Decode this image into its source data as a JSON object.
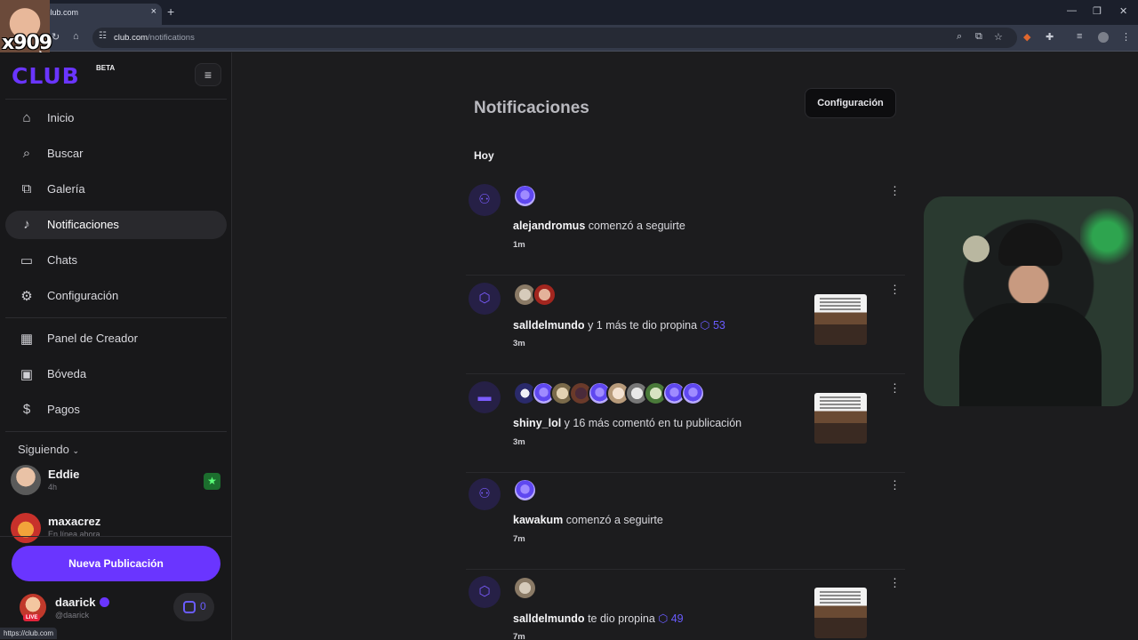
{
  "browser": {
    "tab_title": "club.com",
    "url_host": "club.com",
    "url_path": "/notifications",
    "status_url": "https://club.com"
  },
  "overlay": {
    "streamer_text": "x909"
  },
  "sidebar": {
    "logo": "CLUB",
    "beta": "BETA",
    "nav": [
      {
        "label": "Inicio",
        "icon": "home-icon"
      },
      {
        "label": "Buscar",
        "icon": "search-icon"
      },
      {
        "label": "Galería",
        "icon": "gallery-icon"
      },
      {
        "label": "Notificaciones",
        "icon": "bell-icon",
        "active": true
      },
      {
        "label": "Chats",
        "icon": "chat-icon"
      },
      {
        "label": "Configuración",
        "icon": "gear-icon"
      },
      {
        "label": "Panel de Creador",
        "icon": "dashboard-icon"
      },
      {
        "label": "Bóveda",
        "icon": "vault-icon"
      },
      {
        "label": "Pagos",
        "icon": "dollar-icon"
      }
    ],
    "following_label": "Siguiendo",
    "following": [
      {
        "name": "Eddie",
        "sub": "4h",
        "live": true
      },
      {
        "name": "maxacrez",
        "sub": "En línea ahora"
      }
    ],
    "new_post_label": "Nueva Publicación",
    "me": {
      "name": "daarick",
      "handle": "@daarick",
      "live_label": "LIVE",
      "coins": "0"
    }
  },
  "main": {
    "title": "Notificaciones",
    "config_label": "Configuración",
    "section_today": "Hoy",
    "notifications": [
      {
        "type": "follow",
        "user": "alejandromus",
        "rest": "comenzó a seguirte",
        "amount": "",
        "time": "1m",
        "thumb": false,
        "avatars": 1
      },
      {
        "type": "tip",
        "user": "salldelmundo",
        "rest": "y 1 más te dio propina",
        "amount": "53",
        "time": "3m",
        "thumb": true,
        "avatars": 2
      },
      {
        "type": "comment",
        "user": "shiny_lol",
        "rest": "y 16 más comentó en tu publicación",
        "amount": "",
        "time": "3m",
        "thumb": true,
        "avatars": 9
      },
      {
        "type": "follow",
        "user": "kawakum",
        "rest": "comenzó a seguirte",
        "amount": "",
        "time": "7m",
        "thumb": false,
        "avatars": 1
      },
      {
        "type": "tip",
        "user": "salldelmundo",
        "rest": "te dio propina",
        "amount": "49",
        "time": "7m",
        "thumb": true,
        "avatars": 1
      }
    ]
  },
  "colors": {
    "accent": "#6a35ff",
    "background": "#1c1c1e",
    "sidebar": "#18181a"
  }
}
